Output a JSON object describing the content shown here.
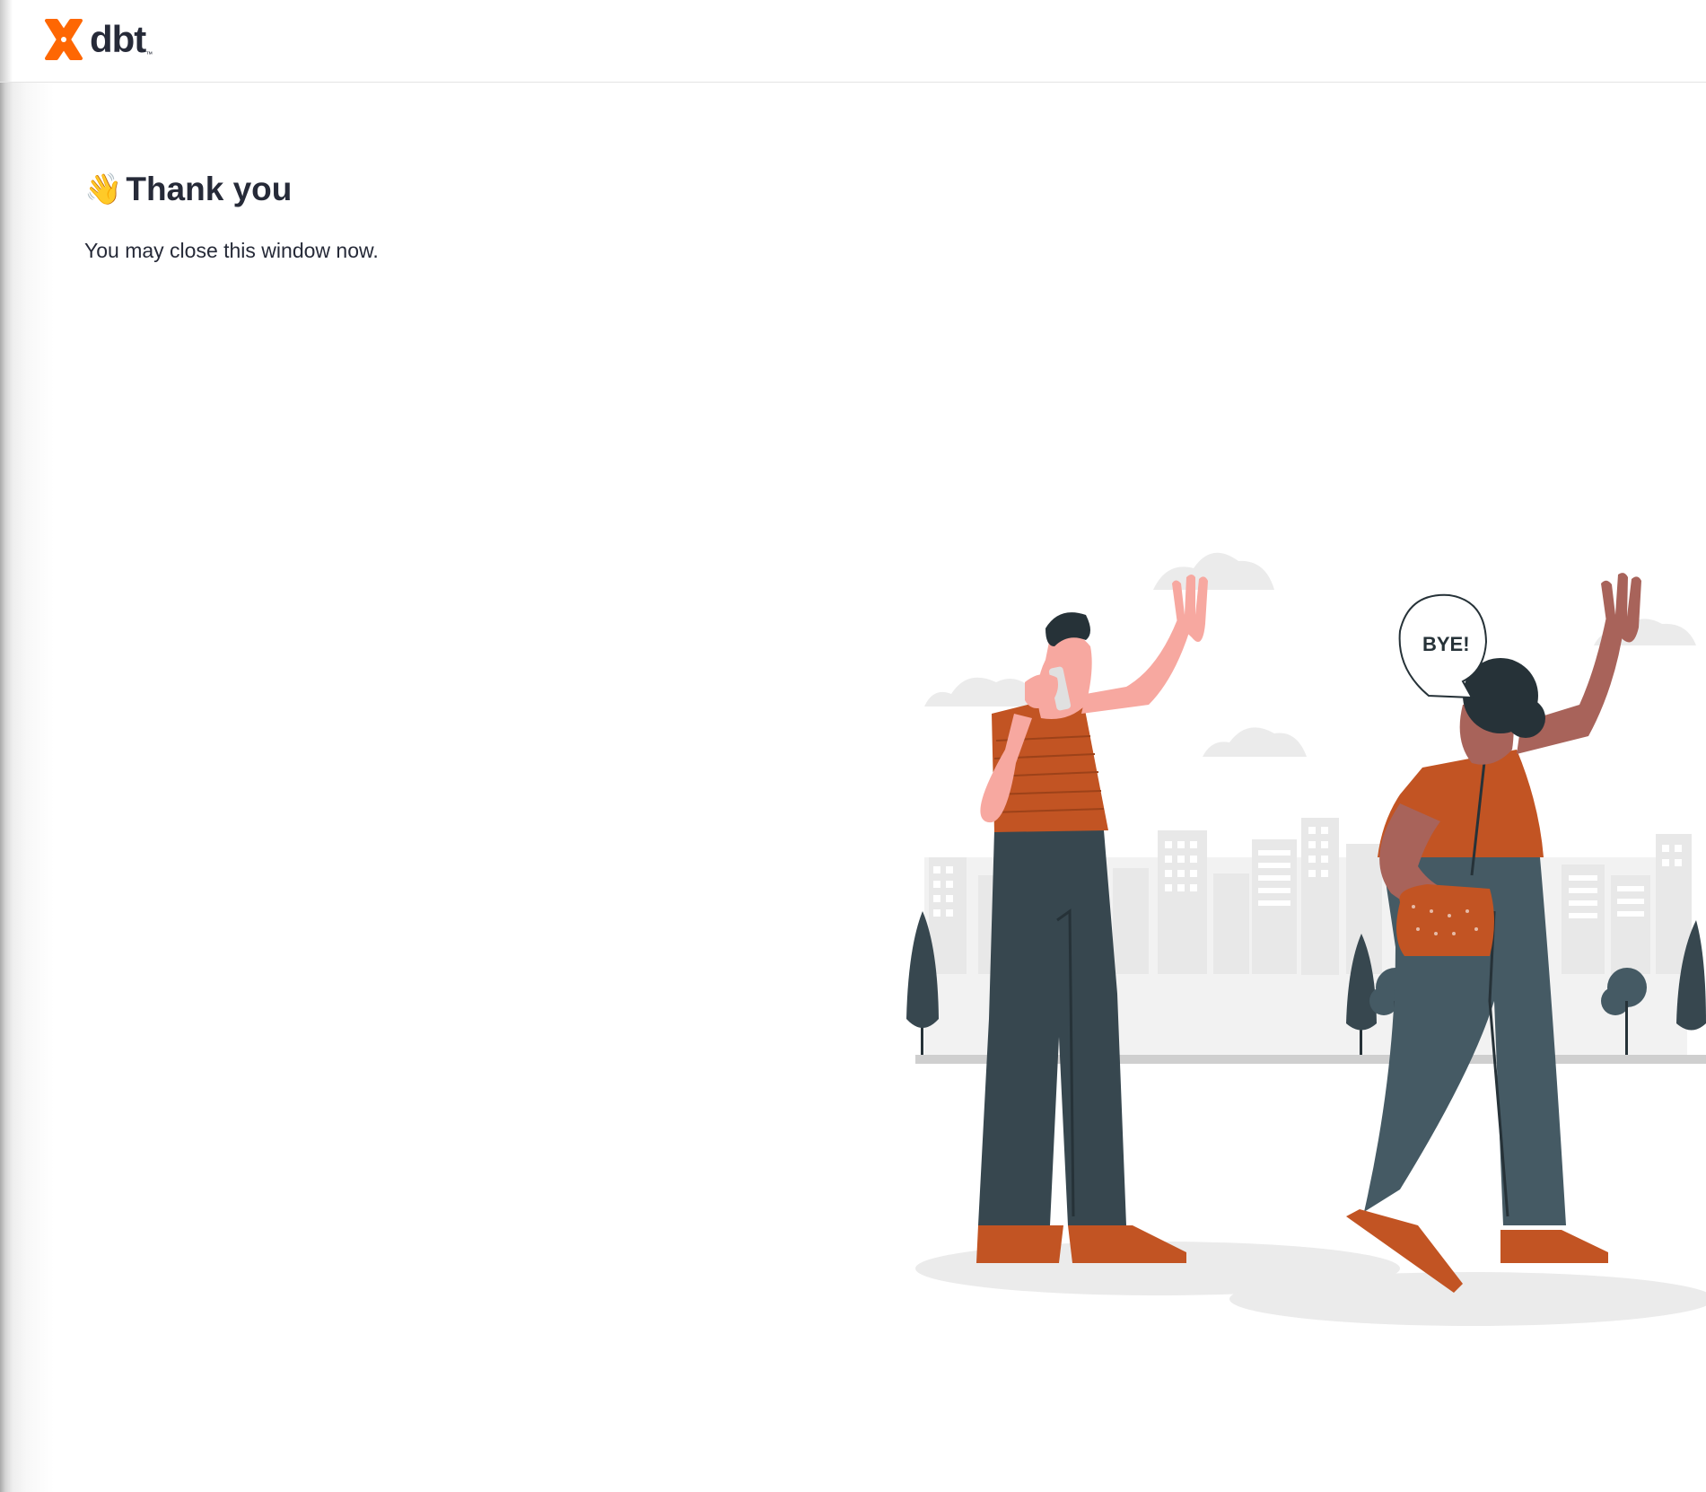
{
  "header": {
    "logo_text": "dbt",
    "logo_tm": "™",
    "logo_icon": "dbt-logo-icon",
    "brand_color": "#fe6703"
  },
  "main": {
    "emoji": "👋",
    "title": "Thank you",
    "message": "You may close this window now."
  },
  "illustration": {
    "speech_text": "BYE!",
    "colors": {
      "shirt": "#c25423",
      "pants_man": "#37474f",
      "pants_woman": "#455a64",
      "skin_man": "#f7a8a0",
      "skin_woman": "#a8635a",
      "city": "#ebebeb"
    }
  }
}
